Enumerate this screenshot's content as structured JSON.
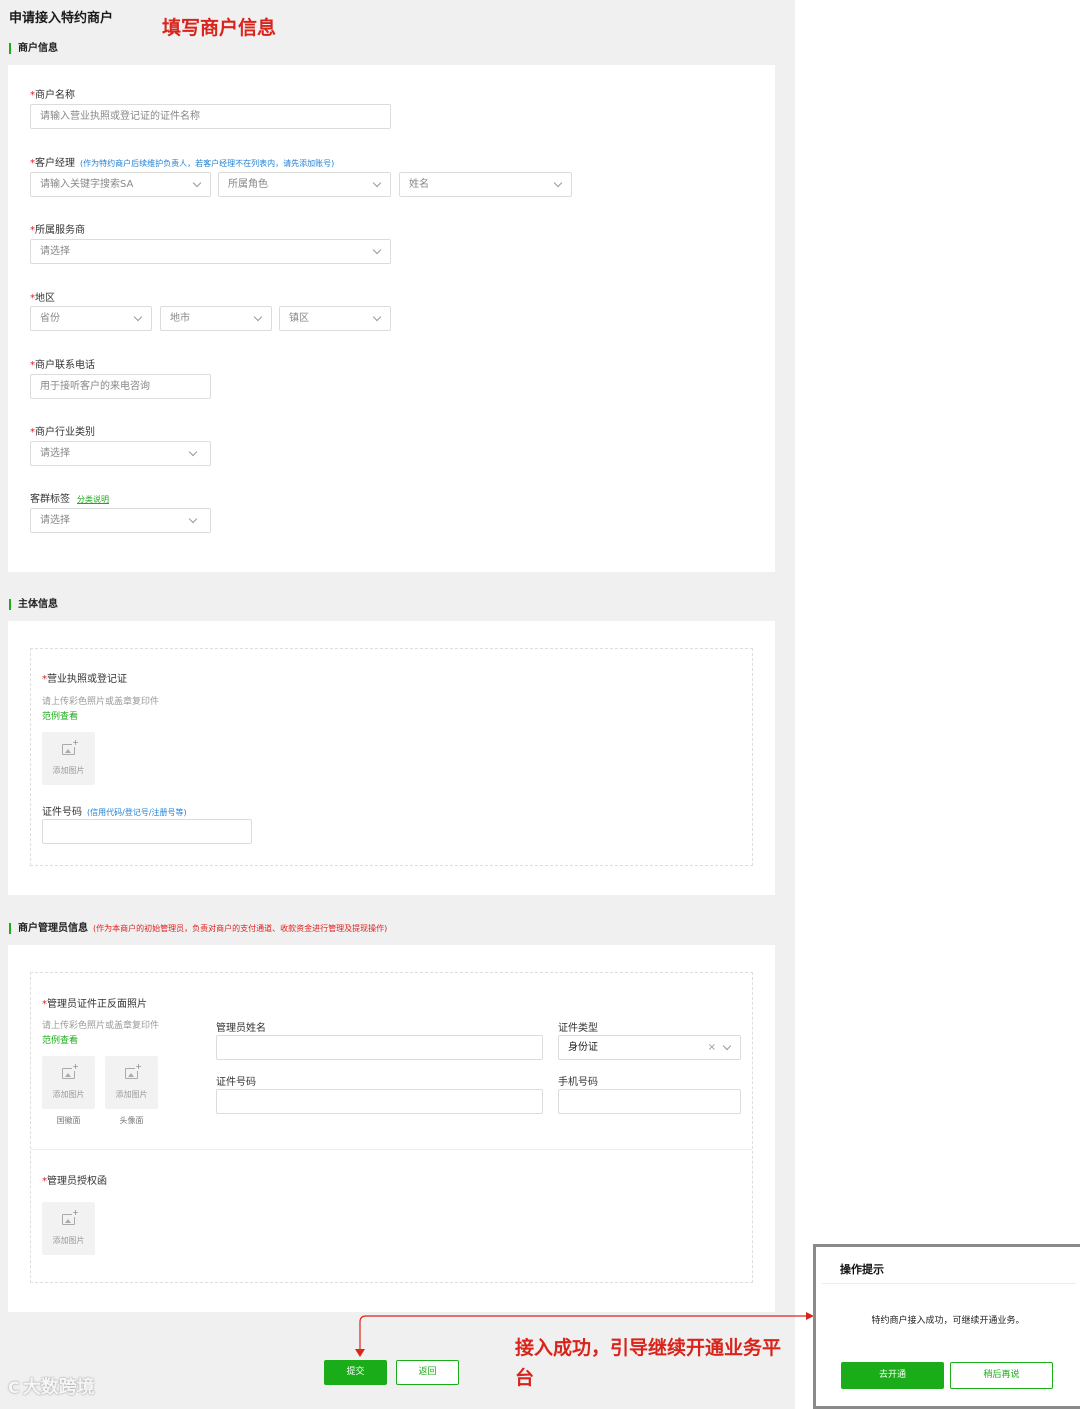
{
  "page": {
    "title": "申请接入特约商户",
    "annotation_top": "填写商户信息",
    "annotation_bottom": "接入成功，引导继续开通业务平台"
  },
  "merchant_info": {
    "section_title": "商户信息",
    "name": {
      "label": "商户名称",
      "placeholder": "请输入营业执照或登记证的证件名称"
    },
    "manager": {
      "label": "客户经理",
      "hint": "(作为特约商户后续维护负责人，若客户经理不在列表内，请先添加账号)",
      "search_placeholder": "请输入关键字搜索SA",
      "role_placeholder": "所属角色",
      "name_placeholder": "姓名"
    },
    "provider": {
      "label": "所属服务商",
      "placeholder": "请选择"
    },
    "region": {
      "label": "地区",
      "province": "省份",
      "city": "地市",
      "district": "镇区"
    },
    "phone": {
      "label": "商户联系电话",
      "placeholder": "用于接听客户的来电咨询"
    },
    "industry": {
      "label": "商户行业类别",
      "placeholder": "请选择"
    },
    "tag": {
      "label": "客群标签",
      "link": "分类说明",
      "placeholder": "请选择"
    }
  },
  "subject_info": {
    "section_title": "主体信息",
    "license": {
      "label": "营业执照或登记证",
      "hint": "请上传彩色照片或盖章复印件",
      "example": "范例查看",
      "upload_text": "添加图片"
    },
    "cert_no": {
      "label": "证件号码",
      "hint": "(信用代码/登记号/注册号等)",
      "value": ""
    }
  },
  "admin_info": {
    "section_title": "商户管理员信息",
    "section_note": "(作为本商户的初始管理员，负责对商户的支付通道、收款资金进行管理及提现操作)",
    "id_photos": {
      "label": "管理员证件正反面照片",
      "hint": "请上传彩色照片或盖章复印件",
      "example": "范例查看",
      "upload_text": "添加图片",
      "front_caption": "国徽面",
      "back_caption": "头像面"
    },
    "admin_name": {
      "label": "管理员姓名",
      "value": ""
    },
    "id_type": {
      "label": "证件类型",
      "value": "身份证",
      "clear": "×"
    },
    "id_no": {
      "label": "证件号码",
      "value": ""
    },
    "mobile": {
      "label": "手机号码",
      "value": ""
    },
    "authorization": {
      "label": "管理员授权函",
      "upload_text": "添加图片"
    }
  },
  "actions": {
    "submit": "提交",
    "back": "返回"
  },
  "watermark": {
    "text": "大数跨境",
    "logo": "C"
  },
  "dialog": {
    "title": "操作提示",
    "message": "特约商户接入成功，可继续开通业务。",
    "primary": "去开通",
    "secondary": "稍后再说"
  },
  "colors": {
    "accent": "#1aad19",
    "required": "#e02020",
    "hint": "#1e7fd6",
    "annotation": "#d9241c"
  }
}
